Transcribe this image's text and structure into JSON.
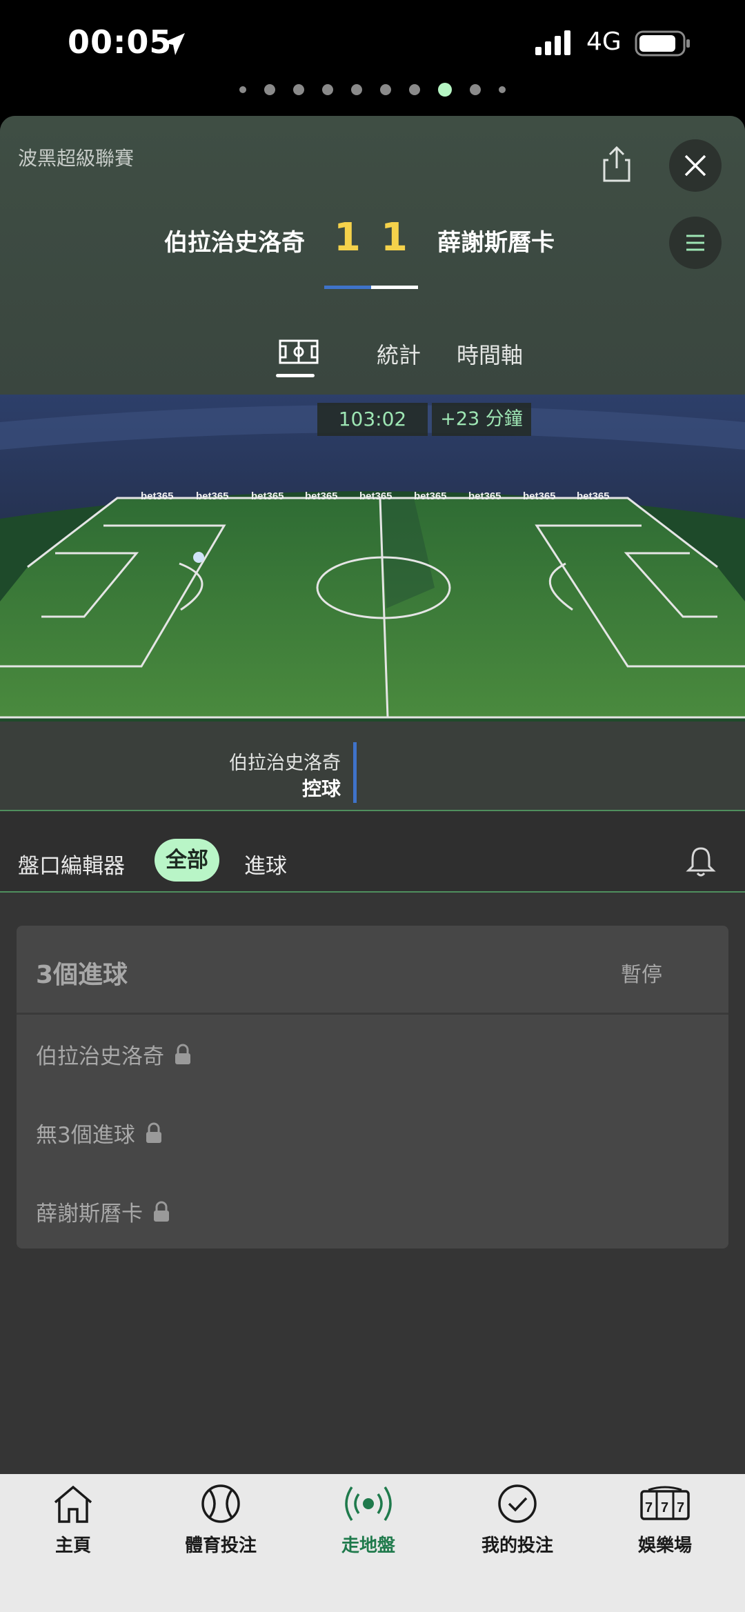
{
  "status": {
    "time": "00:05",
    "network": "4G"
  },
  "header": {
    "league": "波黑超級聯賽",
    "home_team": "伯拉治史洛奇",
    "away_team": "薛謝斯曆卡",
    "home_score": "1",
    "away_score": "1",
    "tabs": {
      "stats": "統計",
      "timeline": "時間軸"
    }
  },
  "pitch": {
    "clock": "103:02",
    "added_time": "+23 分鐘",
    "board": "bet365",
    "possession_team": "伯拉治史洛奇",
    "possession_label": "控球"
  },
  "filter": {
    "title": "盤口編輯器",
    "all": "全部",
    "goals": "進球"
  },
  "market": {
    "title": "3個進球",
    "status": "暫停",
    "selections": [
      "伯拉治史洛奇",
      "無3個進球",
      "薛謝斯曆卡"
    ]
  },
  "nav": {
    "home": "主頁",
    "sports": "體育投注",
    "inplay": "走地盤",
    "mybets": "我的投注",
    "casino": "娛樂場"
  },
  "colors": {
    "accent_green": "#b9f5c7",
    "score_yellow": "#f5d24b",
    "home_blue": "#3f73c9"
  }
}
